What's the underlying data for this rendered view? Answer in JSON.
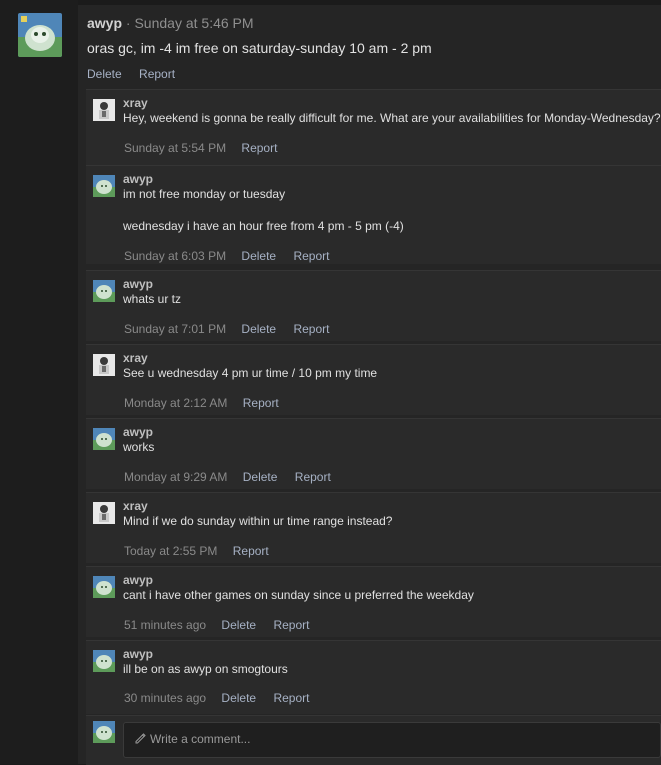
{
  "main_post": {
    "username": "awyp",
    "separator": "·",
    "timestamp": "Sunday at 5:46 PM",
    "body": "oras gc, im -4 im free on saturday-sunday 10 am - 2 pm",
    "actions": [
      "Delete",
      "Report"
    ]
  },
  "comments": [
    {
      "user": "xray",
      "avatar": "xray-avatar",
      "text": "Hey, weekend is gonna be really difficult for me. What are your availabilities for Monday-Wednesday?",
      "time": "Sunday at 5:54 PM",
      "actions": [
        "Report"
      ]
    },
    {
      "user": "awyp",
      "avatar": "awyp-avatar",
      "text": "im not free monday or tuesday\n\nwednesday i have an hour free from 4 pm - 5 pm (-4)",
      "time": "Sunday at 6:03 PM",
      "actions": [
        "Delete",
        "Report"
      ]
    },
    {
      "user": "awyp",
      "avatar": "awyp-avatar",
      "text": "whats ur tz",
      "time": "Sunday at 7:01 PM",
      "actions": [
        "Delete",
        "Report"
      ]
    },
    {
      "user": "xray",
      "avatar": "xray-avatar",
      "text": "See u wednesday 4 pm ur time / 10 pm my time",
      "time": "Monday at 2:12 AM",
      "actions": [
        "Report"
      ]
    },
    {
      "user": "awyp",
      "avatar": "awyp-avatar",
      "text": "works",
      "time": "Monday at 9:29 AM",
      "actions": [
        "Delete",
        "Report"
      ]
    },
    {
      "user": "xray",
      "avatar": "xray-avatar",
      "text": "Mind if we do sunday within ur time range instead?",
      "time": "Today at 2:55 PM",
      "actions": [
        "Report"
      ]
    },
    {
      "user": "awyp",
      "avatar": "awyp-avatar",
      "text": "cant i have other games on sunday since u preferred the weekday",
      "time": "51 minutes ago",
      "actions": [
        "Delete",
        "Report"
      ]
    },
    {
      "user": "awyp",
      "avatar": "awyp-avatar",
      "text": "ill be on as awyp on smogtours",
      "time": "30 minutes ago",
      "actions": [
        "Delete",
        "Report"
      ]
    }
  ],
  "composer": {
    "placeholder": "Write a comment...",
    "icon": "pencil-icon"
  },
  "colors": {
    "background": "#1b1b1b",
    "post_bg": "#252525",
    "comment_bg": "#2a2a2a",
    "link": "#a6b1c4",
    "muted": "#8a8a8a"
  }
}
